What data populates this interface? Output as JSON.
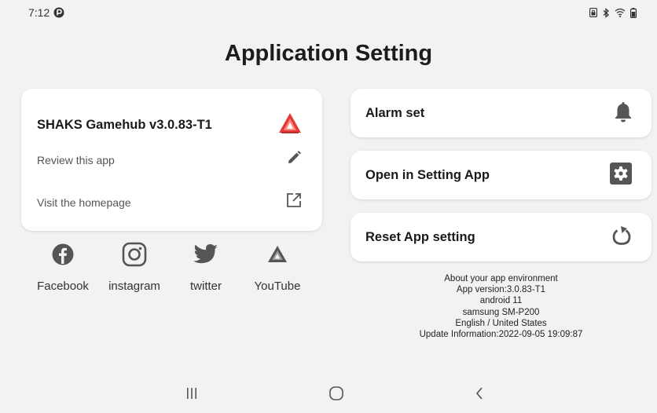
{
  "status_bar": {
    "time": "7:12",
    "icons": [
      "data-saver-icon",
      "sim-lock-icon",
      "bluetooth-icon",
      "wifi-icon",
      "battery-icon"
    ]
  },
  "title": "Application Setting",
  "info_card": {
    "app_name": "SHAKS Gamehub v3.0.83-T1",
    "app_icon": "shaks-logo-icon",
    "review_label": "Review this app",
    "review_icon": "pencil-icon",
    "homepage_label": "Visit the homepage",
    "homepage_icon": "external-link-icon"
  },
  "social": [
    {
      "label": "Facebook",
      "icon": "facebook-icon"
    },
    {
      "label": "instagram",
      "icon": "instagram-icon"
    },
    {
      "label": "twitter",
      "icon": "twitter-icon"
    },
    {
      "label": "YouTube",
      "icon": "shaks-logo-icon"
    }
  ],
  "actions": [
    {
      "label": "Alarm set",
      "icon": "bell-icon"
    },
    {
      "label": "Open in Setting App",
      "icon": "settings-icon"
    },
    {
      "label": "Reset App setting",
      "icon": "reset-icon"
    }
  ],
  "about": {
    "heading": "About your app environment",
    "version": "App version:3.0.83-T1",
    "os": "android 11",
    "device": "samsung SM-P200",
    "locale": "English / United States",
    "update": "Update Information:2022-09-05 19:09:87"
  },
  "nav": {
    "recents": "recents-icon",
    "home": "home-icon",
    "back": "back-icon"
  },
  "colors": {
    "background": "#f2f2f2",
    "card": "#ffffff",
    "brand_red": "#e53935",
    "icon_gray": "#555555"
  }
}
